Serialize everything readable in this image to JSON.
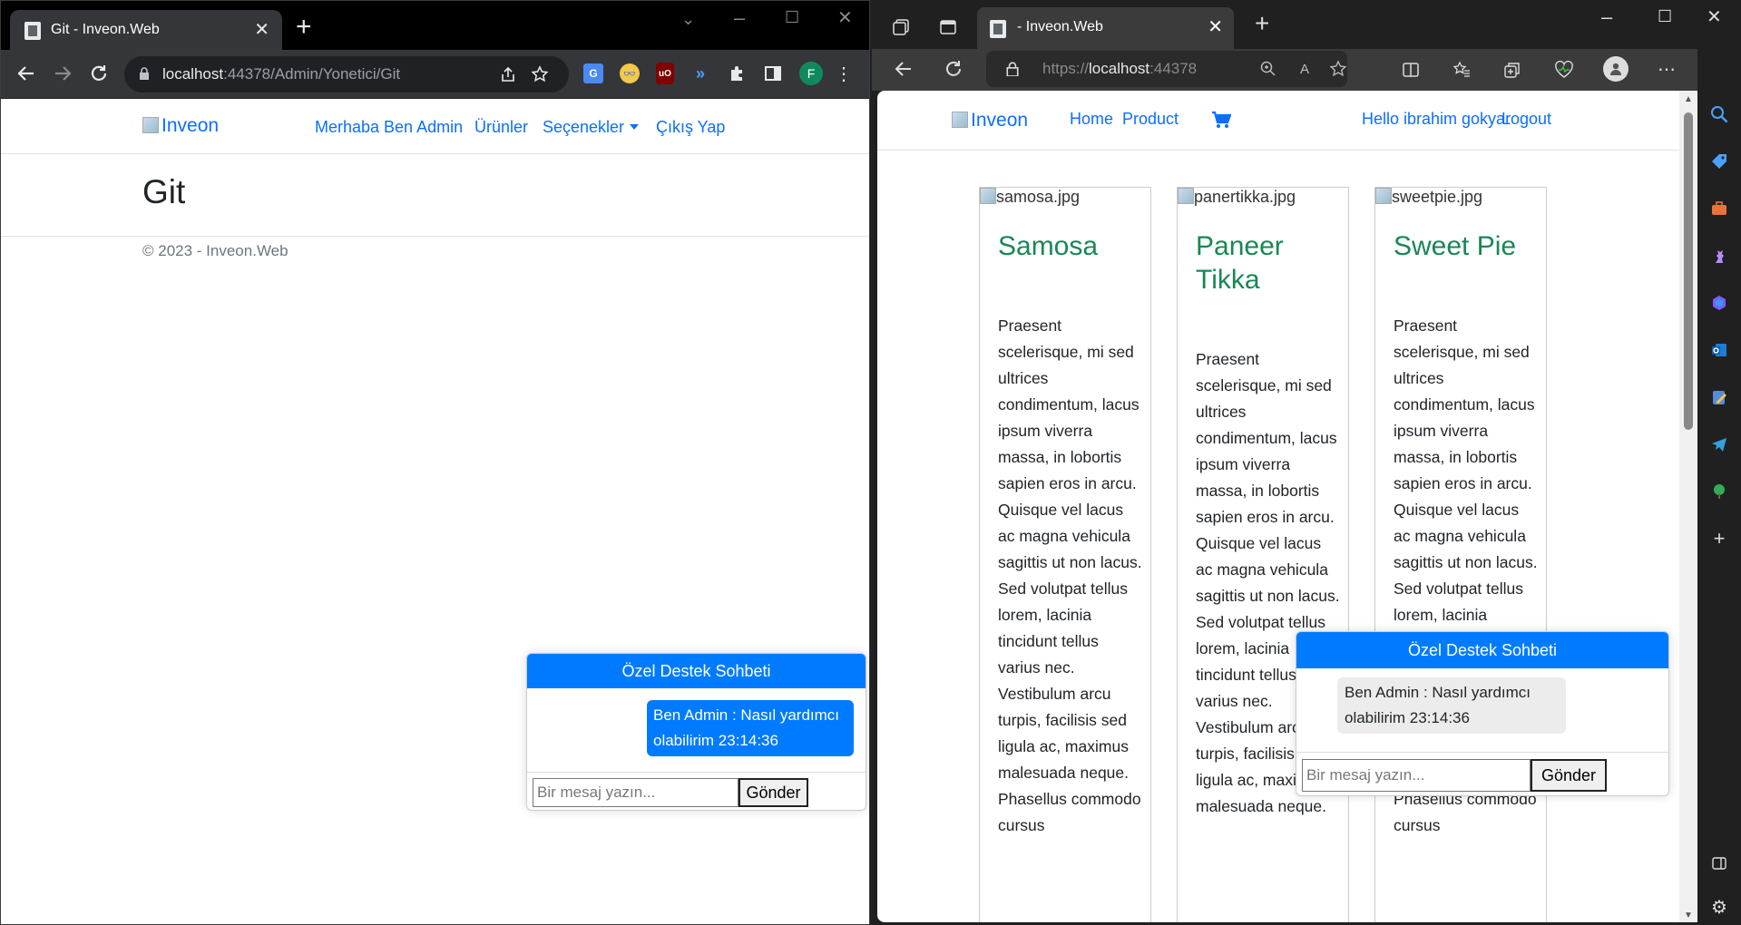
{
  "left_browser": {
    "tab_title": "Git - Inveon.Web",
    "tab_close": "✕",
    "new_tab": "+",
    "url_host": "localhost",
    "url_rest": ":44378/Admin/Yonetici/Git",
    "profile_initial": "F",
    "site": {
      "brand": "Inveon",
      "nav": [
        "Merhaba Ben Admin",
        "Ürünler",
        "Seçenekler",
        "Çıkış Yap"
      ],
      "heading": "Git",
      "footer": "© 2023 - Inveon.Web"
    },
    "chat": {
      "header": "Özel Destek Sohbeti",
      "message": "Ben Admin : Nasıl yardımcı olabilirim 23:14:36",
      "input_placeholder": "Bir mesaj yazın...",
      "send_label": "Gönder"
    }
  },
  "right_browser": {
    "tab_title": "- Inveon.Web",
    "tab_close": "✕",
    "new_tab": "+",
    "url_scheme": "https://",
    "url_host": "localhost",
    "url_port": ":44378",
    "site": {
      "brand": "Inveon",
      "nav": [
        "Home",
        "Product"
      ],
      "greeting": "Hello ibrahim gokyar",
      "logout": "Logout"
    },
    "products": [
      {
        "image_alt": "samosa.jpg",
        "name": "Samosa",
        "description": "Praesent scelerisque, mi sed ultrices condimentum, lacus ipsum viverra massa, in lobortis sapien eros in arcu. Quisque vel lacus ac magna vehicula sagittis ut non lacus. Sed volutpat tellus lorem, lacinia tincidunt tellus varius nec. Vestibulum arcu turpis, facilisis sed ligula ac, maximus malesuada neque. Phasellus commodo cursus"
      },
      {
        "image_alt": "panertikka.jpg",
        "name": "Paneer Tikka",
        "description": "Praesent scelerisque, mi sed ultrices condimentum, lacus ipsum viverra massa, in lobortis sapien eros in arcu. Quisque vel lacus ac magna vehicula sagittis ut non lacus. Sed volutpat tellus lorem, lacinia tincidunt tellus varius nec. Vestibulum arcu turpis, facilisis sed ligula ac, maximus malesuada neque."
      },
      {
        "image_alt": "sweetpie.jpg",
        "name": "Sweet Pie",
        "description": "Praesent scelerisque, mi sed ultrices condimentum, lacus ipsum viverra massa, in lobortis sapien eros in arcu. Quisque vel lacus ac magna vehicula sagittis ut non lacus. Sed volutpat tellus lorem, lacinia tincidunt tellus varius nec. Vestibulum arcu turpis, facilisis sed ligula ac, maximus malesuada neque. Phasellus commodo cursus"
      }
    ],
    "chat": {
      "header": "Özel Destek Sohbeti",
      "message": "Ben Admin : Nasıl yardımcı olabilirim 23:14:36",
      "input_placeholder": "Bir mesaj yazın...",
      "send_label": "Gönder"
    }
  },
  "colors": {
    "link_blue": "#0d6efd",
    "chat_blue": "#007bff",
    "product_green": "#198754"
  }
}
